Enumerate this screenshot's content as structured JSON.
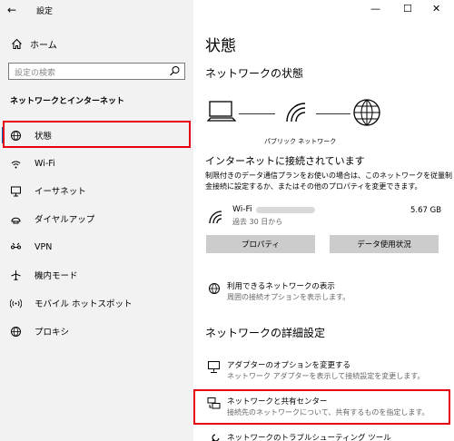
{
  "window": {
    "title": "設定",
    "back_glyph": "←",
    "minimize_glyph": "—",
    "maximize_glyph": "☐",
    "close_glyph": "✕"
  },
  "sidebar": {
    "home_label": "ホーム",
    "search_placeholder": "設定の検索",
    "section_title": "ネットワークとインターネット",
    "items": [
      {
        "label": "状態",
        "icon": "status-globe-icon",
        "selected": true
      },
      {
        "label": "Wi-Fi",
        "icon": "wifi-icon"
      },
      {
        "label": "イーサネット",
        "icon": "ethernet-icon"
      },
      {
        "label": "ダイヤルアップ",
        "icon": "dialup-icon"
      },
      {
        "label": "VPN",
        "icon": "vpn-icon"
      },
      {
        "label": "機内モード",
        "icon": "airplane-icon"
      },
      {
        "label": "モバイル ホットスポット",
        "icon": "hotspot-icon"
      },
      {
        "label": "プロキシ",
        "icon": "globe-icon"
      }
    ]
  },
  "main": {
    "page_title": "状態",
    "network_status_heading": "ネットワークの状態",
    "network_label": "パブリック ネットワーク",
    "connected_heading": "インターネットに接続されています",
    "connected_desc_1": "制限付きのデータ通信プランをお使いの場合は、このネットワークを従量制",
    "connected_desc_2": "金接続に設定するか、またはその他のプロパティを変更できます。",
    "wifi_name": "Wi-Fi",
    "wifi_period": "過去 30 日から",
    "wifi_usage": "5.67 GB",
    "properties_button": "プロパティ",
    "data_usage_button": "データ使用状況",
    "available_networks_title": "利用できるネットワークの表示",
    "available_networks_desc": "周囲の接続オプションを表示します。",
    "advanced_heading": "ネットワークの詳細設定",
    "adapter_title": "アダプターのオプションを変更する",
    "adapter_desc": "ネットワーク アダプターを表示して接続設定を変更します。",
    "sharing_title": "ネットワークと共有センター",
    "sharing_desc": "接続先のネットワークについて、共有するものを指定します。",
    "troubleshoot_title": "ネットワークのトラブルシューティング ツール"
  }
}
